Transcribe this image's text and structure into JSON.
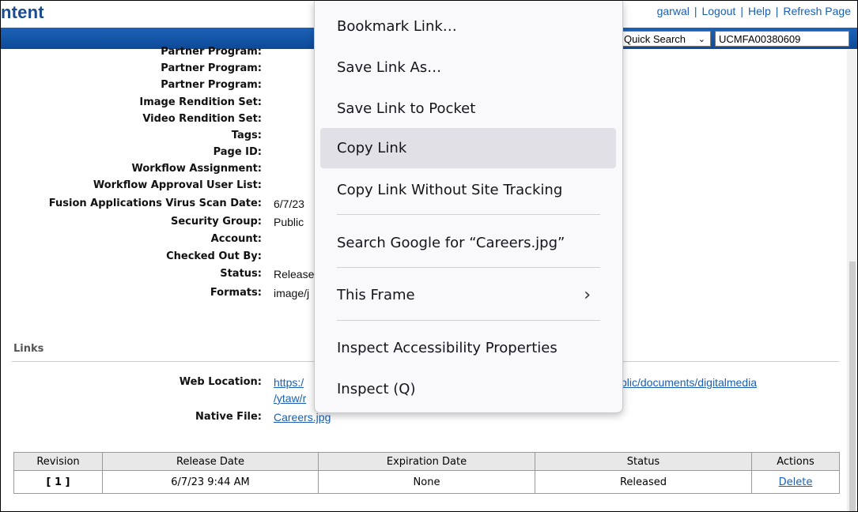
{
  "header": {
    "brand": "ntent",
    "links": [
      "garwal",
      "Logout",
      "Help",
      "Refresh Page"
    ],
    "quick_search_label": "Quick Search",
    "search_value": "UCMFA00380609"
  },
  "fields": [
    {
      "label": "Partner Program:",
      "value": ""
    },
    {
      "label": "Partner Program:",
      "value": ""
    },
    {
      "label": "Partner Program:",
      "value": ""
    },
    {
      "label": "Image Rendition Set:",
      "value": ""
    },
    {
      "label": "Video Rendition Set:",
      "value": ""
    },
    {
      "label": "Tags:",
      "value": ""
    },
    {
      "label": "Page ID:",
      "value": ""
    },
    {
      "label": "Workflow Assignment:",
      "value": ""
    },
    {
      "label": "Workflow Approval User List:",
      "value": ""
    },
    {
      "label": "Fusion Applications Virus Scan Date:",
      "value": "6/7/23"
    },
    {
      "label": "Security Group:",
      "value": "Public"
    },
    {
      "label": "Account:",
      "value": ""
    },
    {
      "label": "Checked Out By:",
      "value": ""
    },
    {
      "label": "Status:",
      "value": "Release"
    },
    {
      "label": "Formats:",
      "value": "image/j"
    }
  ],
  "links_section": {
    "title": "Links",
    "web_location_label": "Web Location:",
    "web_location_part1": "https:/",
    "web_location_part2": "/ytaw/r",
    "web_location_tail": "blic/documents/digitalmedia",
    "native_file_label": "Native File:",
    "native_file": "Careers.jpg"
  },
  "revisions": {
    "headers": [
      "Revision",
      "Release Date",
      "Expiration Date",
      "Status",
      "Actions"
    ],
    "rows": [
      {
        "revision": "[ 1 ]",
        "release_date": "6/7/23 9:44 AM",
        "expiration": "None",
        "status": "Released",
        "action": "Delete"
      }
    ]
  },
  "context_menu": {
    "items": [
      "Bookmark Link…",
      "Save Link As…",
      "Save Link to Pocket",
      "Copy Link",
      "Copy Link Without Site Tracking",
      "Search Google for “Careers.jpg”",
      "This Frame",
      "Inspect Accessibility Properties",
      "Inspect (Q)"
    ],
    "highlighted": "Copy Link"
  }
}
